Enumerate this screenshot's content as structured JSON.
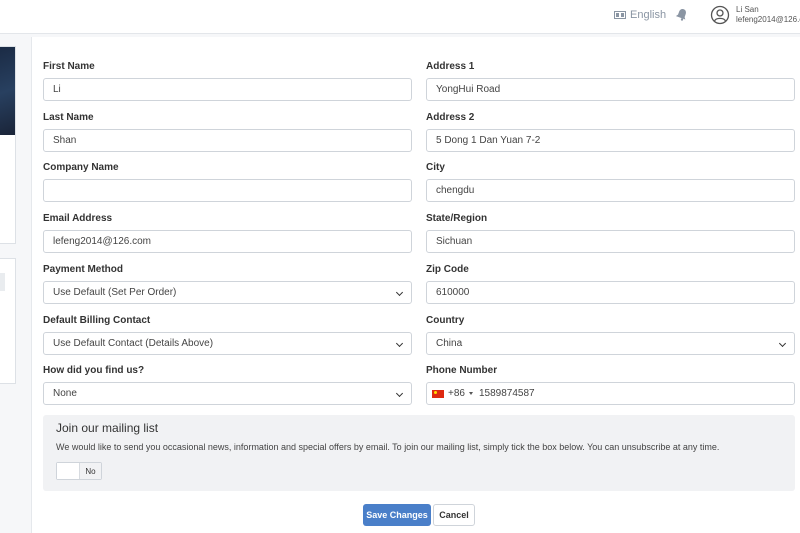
{
  "header": {
    "language": "English",
    "user_name": "Li San",
    "user_email": "lefeng2014@126.co"
  },
  "form": {
    "first_name": {
      "label": "First Name",
      "value": "Li"
    },
    "last_name": {
      "label": "Last Name",
      "value": "Shan"
    },
    "company_name": {
      "label": "Company Name",
      "value": ""
    },
    "email": {
      "label": "Email Address",
      "value": "lefeng2014@126.com"
    },
    "payment_method": {
      "label": "Payment Method",
      "value": "Use Default (Set Per Order)"
    },
    "billing_contact": {
      "label": "Default Billing Contact",
      "value": "Use Default Contact (Details Above)"
    },
    "found_us": {
      "label": "How did you find us?",
      "value": "None"
    },
    "address1": {
      "label": "Address 1",
      "value": "YongHui Road"
    },
    "address2": {
      "label": "Address 2",
      "value": "5 Dong 1 Dan Yuan 7-2"
    },
    "city": {
      "label": "City",
      "value": "chengdu"
    },
    "state": {
      "label": "State/Region",
      "value": "Sichuan"
    },
    "zip": {
      "label": "Zip Code",
      "value": "610000"
    },
    "country": {
      "label": "Country",
      "value": "China"
    },
    "phone": {
      "label": "Phone Number",
      "dial_code": "+86",
      "value": "1589874587"
    }
  },
  "mailing": {
    "title": "Join our mailing list",
    "description": "We would like to send you occasional news, information and special offers by email. To join our mailing list, simply tick the box below. You can unsubscribe at any time.",
    "toggle_state": "No"
  },
  "actions": {
    "save_label": "Save Changes",
    "cancel_label": "Cancel"
  }
}
